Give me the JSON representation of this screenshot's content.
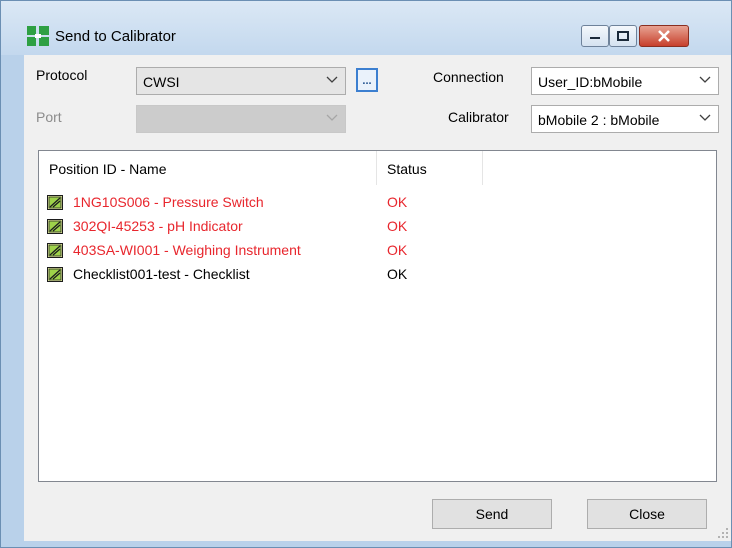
{
  "window": {
    "title": "Send to Calibrator"
  },
  "form": {
    "protocol_label": "Protocol",
    "protocol_value": "CWSI",
    "ellipsis_label": "...",
    "port_label": "Port",
    "port_value": "",
    "connection_label": "Connection",
    "connection_value": "User_ID:bMobile",
    "calibrator_label": "Calibrator",
    "calibrator_value": "bMobile 2 : bMobile"
  },
  "list": {
    "columns": [
      "Position ID - Name",
      "Status"
    ],
    "rows": [
      {
        "name": "1NG10S006 - Pressure Switch",
        "status": "OK",
        "highlight": true
      },
      {
        "name": "302QI-45253 - pH Indicator",
        "status": "OK",
        "highlight": true
      },
      {
        "name": "403SA-WI001 - Weighing Instrument",
        "status": "OK",
        "highlight": true
      },
      {
        "name": "Checklist001-test - Checklist",
        "status": "OK",
        "highlight": false
      }
    ]
  },
  "buttons": {
    "send_label": "Send",
    "close_label": "Close"
  },
  "colors": {
    "highlight_text": "#e8262d",
    "window_frame": "#b9d1ea",
    "accent": "#3c7fd0"
  },
  "icons": {
    "app": "calibrator-app-icon",
    "row": "position-item-icon"
  }
}
